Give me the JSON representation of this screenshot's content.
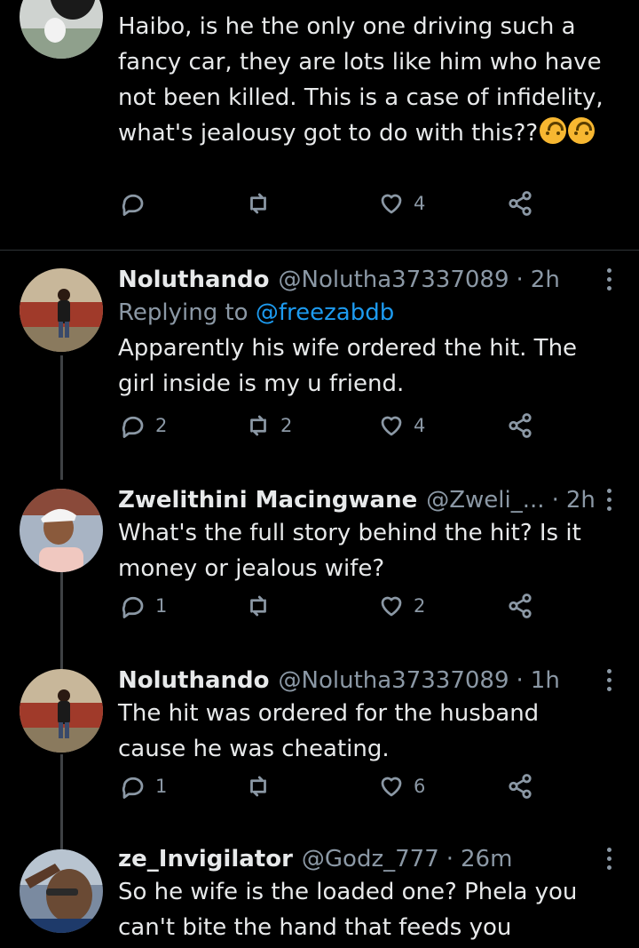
{
  "tweets": [
    {
      "avatar": "woman-photo-avatar",
      "text": "Haibo, is he the only one driving such a fancy car, they are lots like him who have not been killed. This is a case of infidelity, what's jealousy got to do with this??",
      "emojis": [
        "upside-down-face-emoji",
        "upside-down-face-emoji"
      ],
      "reply_count": "",
      "retweet_count": "",
      "like_count": "4"
    },
    {
      "avatar": "woman-photo-avatar",
      "name": "Noluthando",
      "handle": "@Nolutha37337089",
      "dot": "·",
      "time": "2h",
      "replying_label": "Replying to",
      "replying_to": "@freezabdb",
      "text": "Apparently his wife ordered the hit. The girl inside is my u friend.",
      "reply_count": "2",
      "retweet_count": "2",
      "like_count": "4"
    },
    {
      "avatar": "man-cap-avatar",
      "name": "Zwelithini Macingwane",
      "handle": "@Zweli_...",
      "dot": "·",
      "time": "2h",
      "text": "What's the full story behind the hit? Is it money or jealous wife?",
      "reply_count": "1",
      "retweet_count": "",
      "like_count": "2"
    },
    {
      "avatar": "woman-photo-avatar",
      "name": "Noluthando",
      "handle": "@Nolutha37337089",
      "dot": "·",
      "time": "1h",
      "text": "The hit was ordered for the husband cause he was cheating.",
      "reply_count": "1",
      "retweet_count": "",
      "like_count": "6"
    },
    {
      "avatar": "man-saluting-avatar",
      "name": "ze_Invigilator",
      "handle": "@Godz_777",
      "dot": "·",
      "time": "26m",
      "text": "So he wife is the loaded one? Phela you can't bite the hand that feeds you",
      "reply_count": "",
      "retweet_count": "",
      "like_count": ""
    }
  ],
  "colors": {
    "background": "#000000",
    "text": "#e7e9ea",
    "secondary": "#8b98a5",
    "link": "#1d9bf0",
    "divider": "#2f3336"
  },
  "icons": [
    "reply-icon",
    "retweet-icon",
    "like-icon",
    "share-icon",
    "more-icon"
  ]
}
